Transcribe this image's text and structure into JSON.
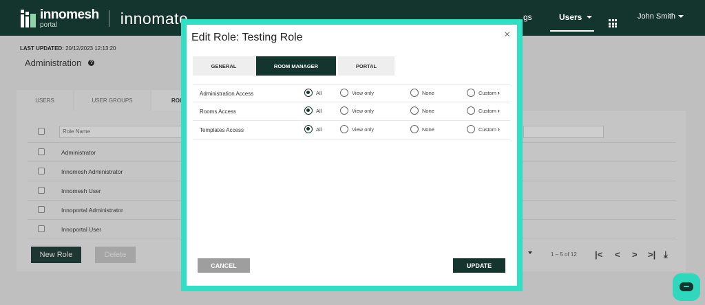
{
  "header": {
    "brand_main": "innomesh",
    "brand_sub": "portal",
    "product": "innomate",
    "nav_partial": "gs",
    "nav_users": "Users",
    "user_name": "John Smith"
  },
  "page": {
    "last_updated_label": "LAST UPDATED:",
    "last_updated_value": "20/12/2023 12:13:20",
    "title": "Administration",
    "help_icon": "?"
  },
  "bg_tabs": [
    "USERS",
    "USER GROUPS",
    "ROL"
  ],
  "table": {
    "column_header": "Role Name",
    "rows": [
      "Administrator",
      "Innomesh Administrator",
      "Innomesh User",
      "Innoportal Administrator",
      "Innoportal User"
    ]
  },
  "actions": {
    "new_role": "New Role",
    "delete": "Delete"
  },
  "pagination": {
    "range": "1 – 5 of 12",
    "first": "|<",
    "prev": "<",
    "next": ">",
    "last": ">|",
    "download": "⤓"
  },
  "modal": {
    "title": "Edit Role: Testing Role",
    "close": "×",
    "tabs": [
      {
        "label": "GENERAL",
        "active": false
      },
      {
        "label": "ROOM MANAGER",
        "active": true
      },
      {
        "label": "PORTAL",
        "active": false
      }
    ],
    "options": [
      "All",
      "View only",
      "None",
      "Custom"
    ],
    "chevron": "›",
    "permissions": [
      {
        "name": "Administration Access",
        "selected": "All"
      },
      {
        "name": "Rooms Access",
        "selected": "All"
      },
      {
        "name": "Templates Access",
        "selected": "All"
      }
    ],
    "cancel": "CANCEL",
    "update": "UPDATE"
  },
  "colors": {
    "brand_dark": "#14352e",
    "accent": "#30e0c4",
    "chat": "#2fd8bd"
  },
  "icons": {
    "close": "close-icon",
    "apps": "grid-icon",
    "help": "help-icon",
    "chat": "chat-icon"
  }
}
